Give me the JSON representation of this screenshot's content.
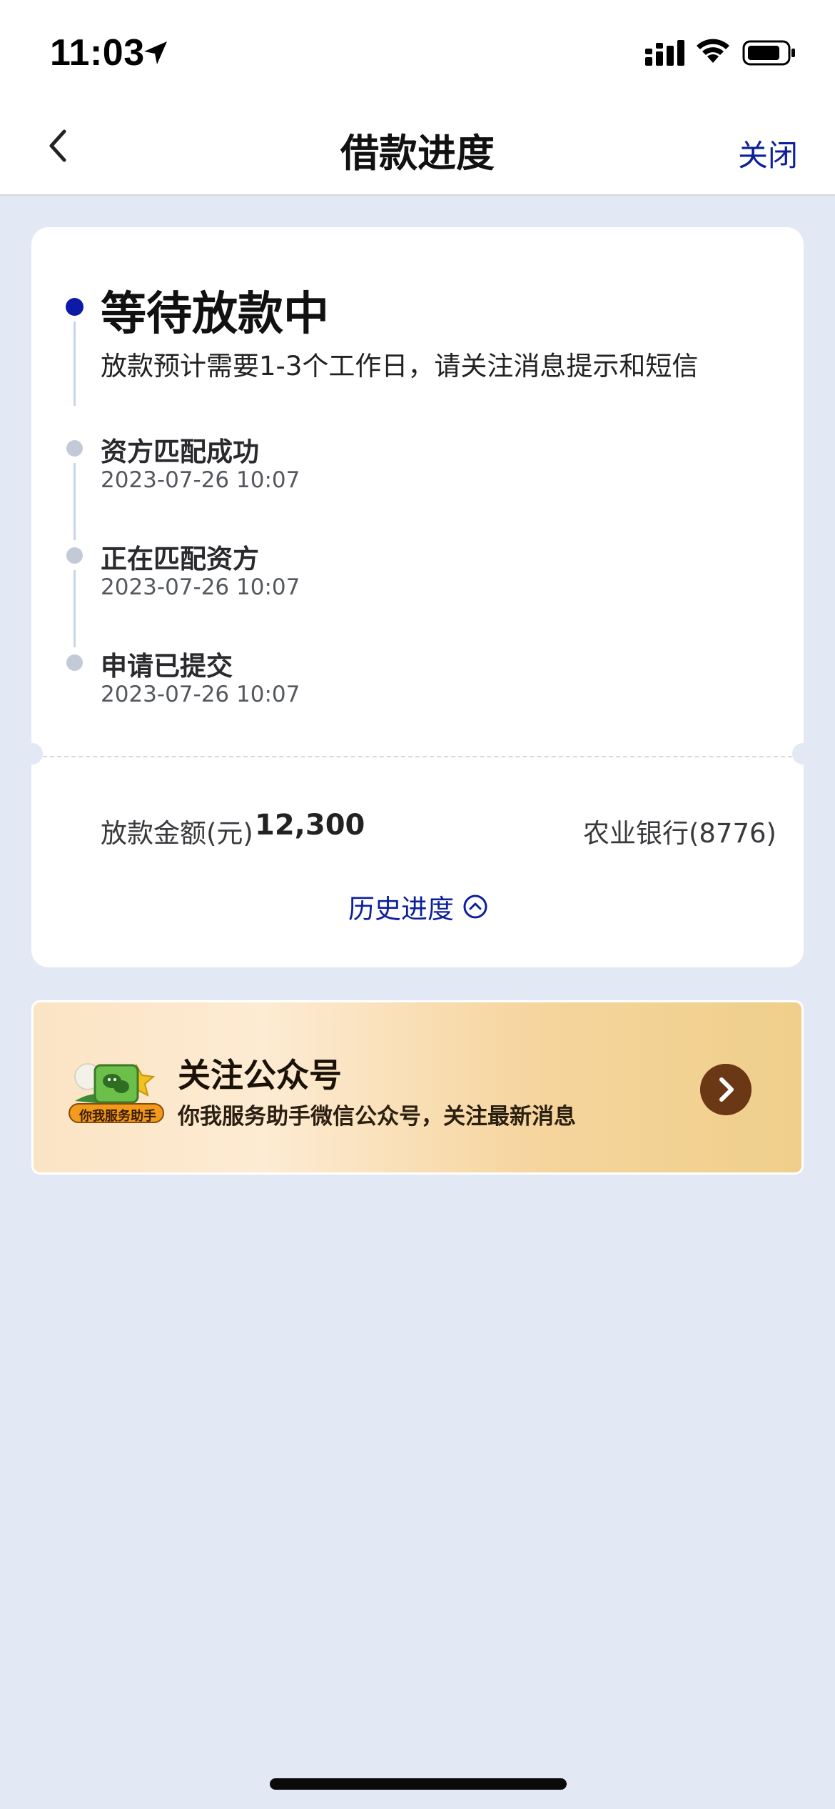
{
  "status_bar": {
    "time": "11:03"
  },
  "nav": {
    "title": "借款进度",
    "close_label": "关闭"
  },
  "progress": {
    "current": {
      "title": "等待放款中",
      "desc": "放款预计需要1-3个工作日，请关注消息提示和短信"
    },
    "steps": [
      {
        "title": "资方匹配成功",
        "time": "2023-07-26 10:07"
      },
      {
        "title": "正在匹配资方",
        "time": "2023-07-26 10:07"
      },
      {
        "title": "申请已提交",
        "time": "2023-07-26 10:07"
      }
    ],
    "amount_label": "放款金额(元)",
    "amount_value": "12,300",
    "bank": "农业银行(8776)",
    "history_label": "历史进度"
  },
  "banner": {
    "title": "关注公众号",
    "subtitle": "你我服务助手微信公众号，关注最新消息",
    "logo_text": "你我服务助手"
  },
  "colors": {
    "accent": "#0d1f9c",
    "active_dot": "#0d1aa8",
    "done_dot": "#c2cad8",
    "background": "#e3e9f4",
    "banner_arrow": "#6b3815"
  },
  "icons": [
    "location-arrow-icon",
    "signal-icon",
    "wifi-icon",
    "battery-icon",
    "back-chevron-icon",
    "chevron-up-circle-icon",
    "wechat-logo-icon",
    "chevron-right-icon"
  ]
}
